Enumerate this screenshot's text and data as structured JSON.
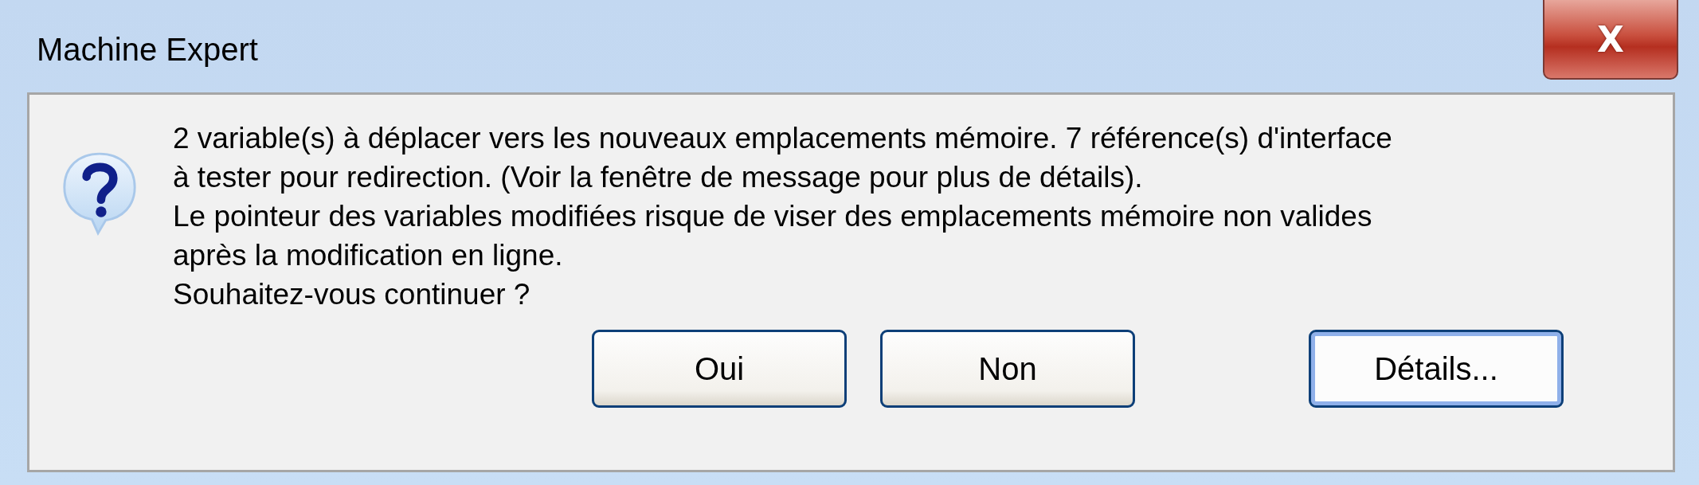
{
  "window": {
    "title": "Machine Expert",
    "close_label": "X"
  },
  "message": {
    "lines": [
      "2 variable(s) à déplacer vers les nouveaux emplacements mémoire. 7 référence(s) d'interface",
      "à tester pour redirection. (Voir la fenêtre de message pour plus de détails).",
      "Le pointeur des variables modifiées risque de viser des emplacements mémoire non valides",
      "après la modification en ligne.",
      "Souhaitez-vous continuer ?"
    ]
  },
  "buttons": [
    {
      "label": "Oui",
      "default": false
    },
    {
      "label": "Non",
      "default": false
    },
    {
      "label": "Détails...",
      "default": true
    }
  ]
}
